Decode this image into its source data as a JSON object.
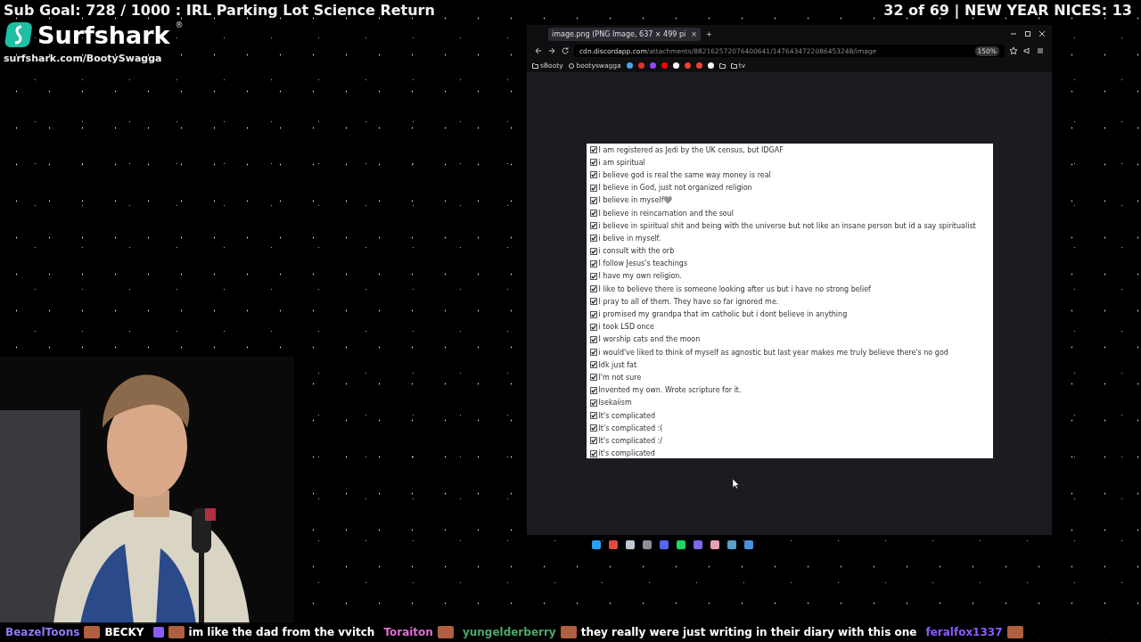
{
  "overlay": {
    "sub_goal": "Sub Goal: 728 / 1000 : IRL Parking Lot Science Return",
    "counter": "32 of 69 | NEW YEAR NICES: 13",
    "sponsor": {
      "name": "Surfshark",
      "mark": "®",
      "url": "surfshark.com/BootySwagga"
    }
  },
  "browser": {
    "tab": {
      "title": "image.png (PNG Image, 637 × 499 pi",
      "close": "×",
      "selected": true
    },
    "new_tab": "+",
    "url": {
      "host": "cdn.discordapp.com",
      "path": "/attachments/882162572076400641/1476434722086453248/image"
    },
    "zoom": "150%",
    "bookmarks": [
      {
        "kind": "folder",
        "label": "sBooty"
      },
      {
        "kind": "site",
        "label": "bootyswagga"
      },
      {
        "kind": "icon",
        "color": "#4aa3df"
      },
      {
        "kind": "icon",
        "color": "#e0302a"
      },
      {
        "kind": "icon",
        "color": "#9146ff"
      },
      {
        "kind": "icon",
        "color": "#ff0000"
      },
      {
        "kind": "icon",
        "color": "#ffffff"
      },
      {
        "kind": "icon",
        "color": "#ea4335"
      },
      {
        "kind": "icon",
        "color": "#ea4335"
      },
      {
        "kind": "icon",
        "color": "#f5f5f5"
      },
      {
        "kind": "folder"
      },
      {
        "kind": "folder",
        "label": "tv"
      }
    ],
    "options": [
      {
        "label": "I am registered as Jedi by the UK census, but IDGAF",
        "checked": true
      },
      {
        "label": "i am spiritual",
        "checked": true
      },
      {
        "label": "i believe god is real the same way money is real",
        "checked": true
      },
      {
        "label": "I believe in God, just not organized religion",
        "checked": true
      },
      {
        "label": "I believe in myself🩶",
        "checked": true
      },
      {
        "label": "I believe in reincarnation and the soul",
        "checked": true
      },
      {
        "label": "i believe in spiritual shit and being with the universe but not like an insane person but id a say spiritualist",
        "checked": true
      },
      {
        "label": "i belive in myself.",
        "checked": true
      },
      {
        "label": "i consult with the orb",
        "checked": true
      },
      {
        "label": "I follow Jesus's teachings",
        "checked": true
      },
      {
        "label": "I have my own religion.",
        "checked": true
      },
      {
        "label": "I like to believe there is someone looking after us but i have no strong belief",
        "checked": true
      },
      {
        "label": "I pray to all of them. They have so far ignored me.",
        "checked": true
      },
      {
        "label": "i promised my grandpa that im catholic but i dont believe in anything",
        "checked": true
      },
      {
        "label": "i took LSD once",
        "checked": true
      },
      {
        "label": "I worship cats and the moon",
        "checked": true
      },
      {
        "label": "i would've liked to think of myself as agnostic but last year makes me truly believe there's no god",
        "checked": true
      },
      {
        "label": "Idk just fat",
        "checked": true
      },
      {
        "label": "I'm not sure",
        "checked": true
      },
      {
        "label": "Invented my own. Wrote scripture for it.",
        "checked": true
      },
      {
        "label": "Isekaiism",
        "checked": true
      },
      {
        "label": "It's complicated",
        "checked": true
      },
      {
        "label": "It's complicated :(",
        "checked": true
      },
      {
        "label": "It's complicated :/",
        "checked": true
      },
      {
        "label": "it's complicated",
        "checked": true
      }
    ]
  },
  "taskbar": [
    {
      "color": "#2aa0f0"
    },
    {
      "color": "#e04a3a"
    },
    {
      "color": "#c0c8d0"
    },
    {
      "color": "#8a8f98"
    },
    {
      "color": "#5865f2"
    },
    {
      "color": "#1ed760"
    },
    {
      "color": "#7b68ee"
    },
    {
      "color": "#e8a0b0"
    },
    {
      "color": "#5aa0c8"
    },
    {
      "color": "#4a90e2"
    }
  ],
  "chat": [
    {
      "user": "BeazelToons",
      "color": "#8a7cff",
      "text": "BECKY"
    },
    {
      "color": "#8a5cff",
      "text": "im like the dad from the vvitch"
    },
    {
      "user": "Toraiton",
      "color": "#e070d0"
    },
    {
      "user": "yungelderberry",
      "color": "#4ea86a",
      "text": "they really were just writing in their diary with this one"
    },
    {
      "user": "feralfox1337",
      "color": "#8a5cff"
    }
  ]
}
